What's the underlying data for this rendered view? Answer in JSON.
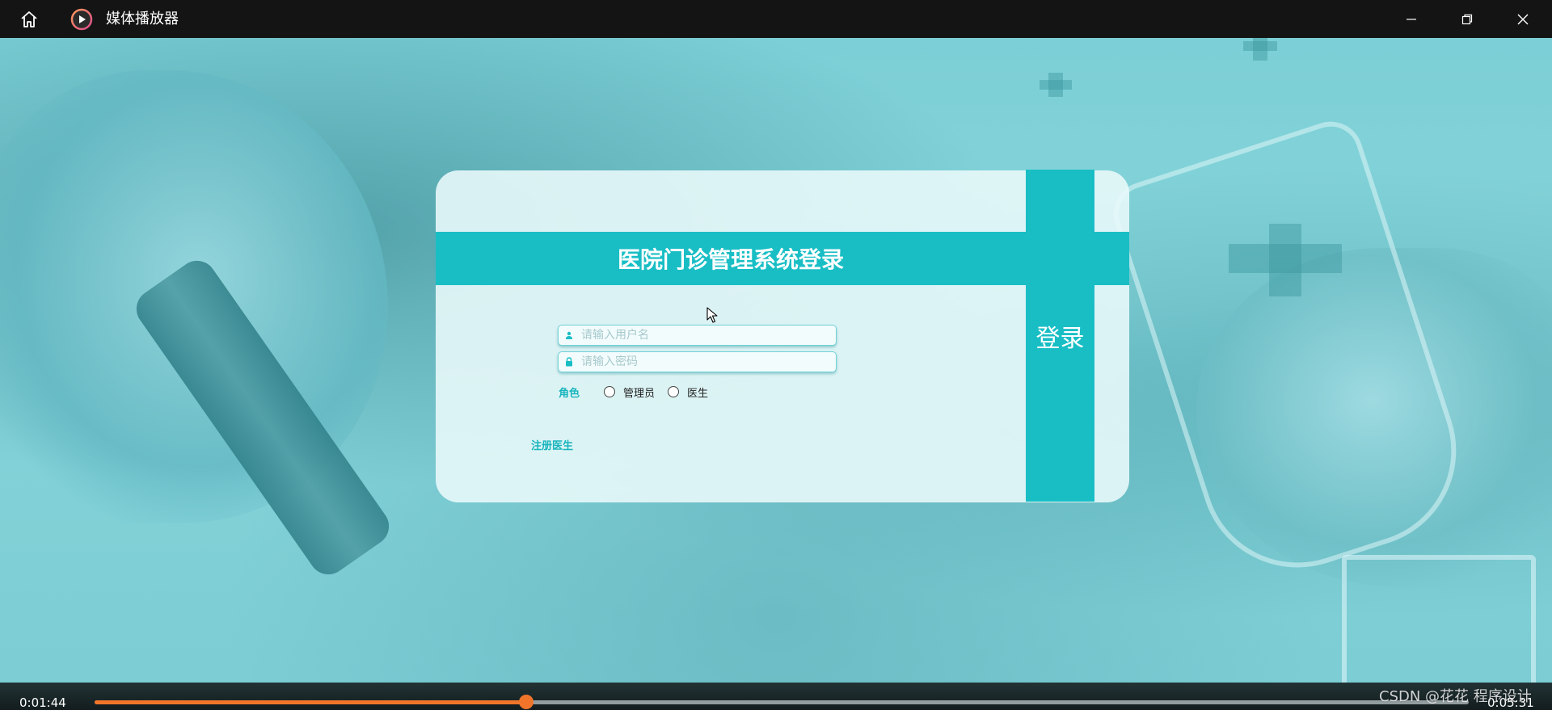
{
  "window": {
    "title": "媒体播放器"
  },
  "login": {
    "title": "医院门诊管理系统登录",
    "login_button": "登录",
    "username_placeholder": "请输入用户名",
    "password_placeholder": "请输入密码",
    "role_label": "角色",
    "roles": [
      "管理员",
      "医生"
    ],
    "register_link": "注册医生",
    "accent_color": "#19bec5"
  },
  "player": {
    "current_time": "0:01:44",
    "total_time": "0:05:31",
    "progress": 0.314,
    "accent_color": "#f0752a"
  },
  "watermark": "CSDN @花花 程序设计"
}
